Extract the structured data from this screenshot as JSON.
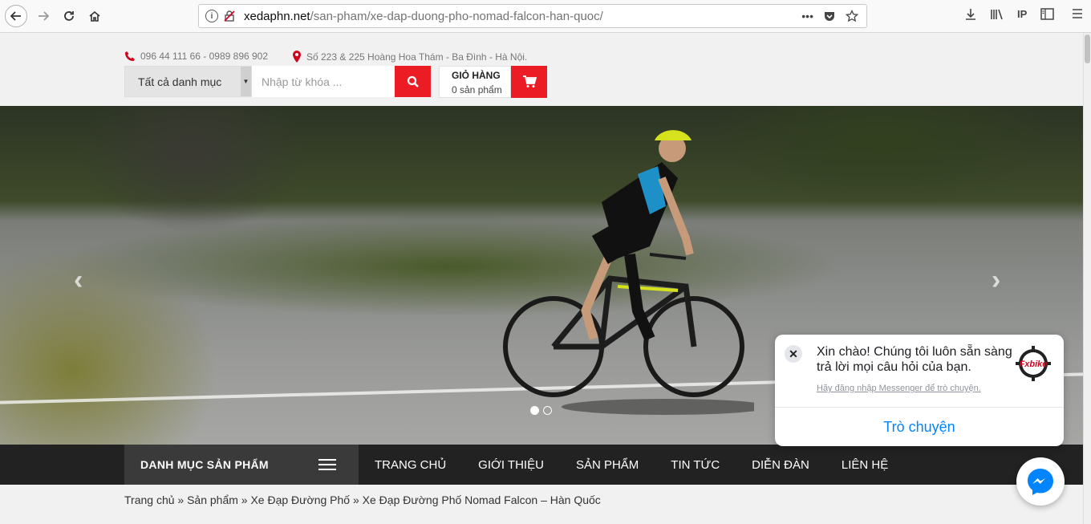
{
  "browser": {
    "url_host": "xedaphn.net",
    "url_path": "/san-pham/xe-dap-duong-pho-nomad-falcon-han-quoc/",
    "more_label": "•••",
    "toolbar_text_ip": "IP"
  },
  "header": {
    "phone": "096 44 111 66 - 0989 896 902",
    "address": "Số 223 & 225 Hoàng Hoa Thám - Ba Đình - Hà Nội.",
    "category_select": "Tất cả danh mục",
    "search_placeholder": "Nhập từ khóa ...",
    "cart_title": "GIỎ HÀNG",
    "cart_count": "0 sản phẩm"
  },
  "hero": {
    "prev": "‹",
    "next": "›",
    "slides": 2,
    "active_slide": 1
  },
  "nav": {
    "category_label": "DANH MỤC SẢN PHẨM",
    "items": [
      "TRANG CHỦ",
      "GIỚI THIỆU",
      "SẢN PHẨM",
      "TIN TỨC",
      "DIỄN ĐÀN",
      "LIÊN HỆ"
    ]
  },
  "breadcrumb": "Trang chủ » Sản phẩm » Xe Đạp Đường Phố » Xe Đạp Đường Phố Nomad Falcon – Hàn Quốc",
  "messenger": {
    "greeting": "Xin chào! Chúng tôi luôn sẵn sàng trả lời mọi câu hỏi của bạn.",
    "login_hint": "Hãy đăng nhập Messenger để trò chuyện.",
    "chat_button": "Trò chuyện",
    "logo_text": "Fxbike",
    "close": "✕"
  },
  "colors": {
    "accent": "#ec1c24",
    "nav_bg": "#222222",
    "messenger_blue": "#0084ff"
  }
}
